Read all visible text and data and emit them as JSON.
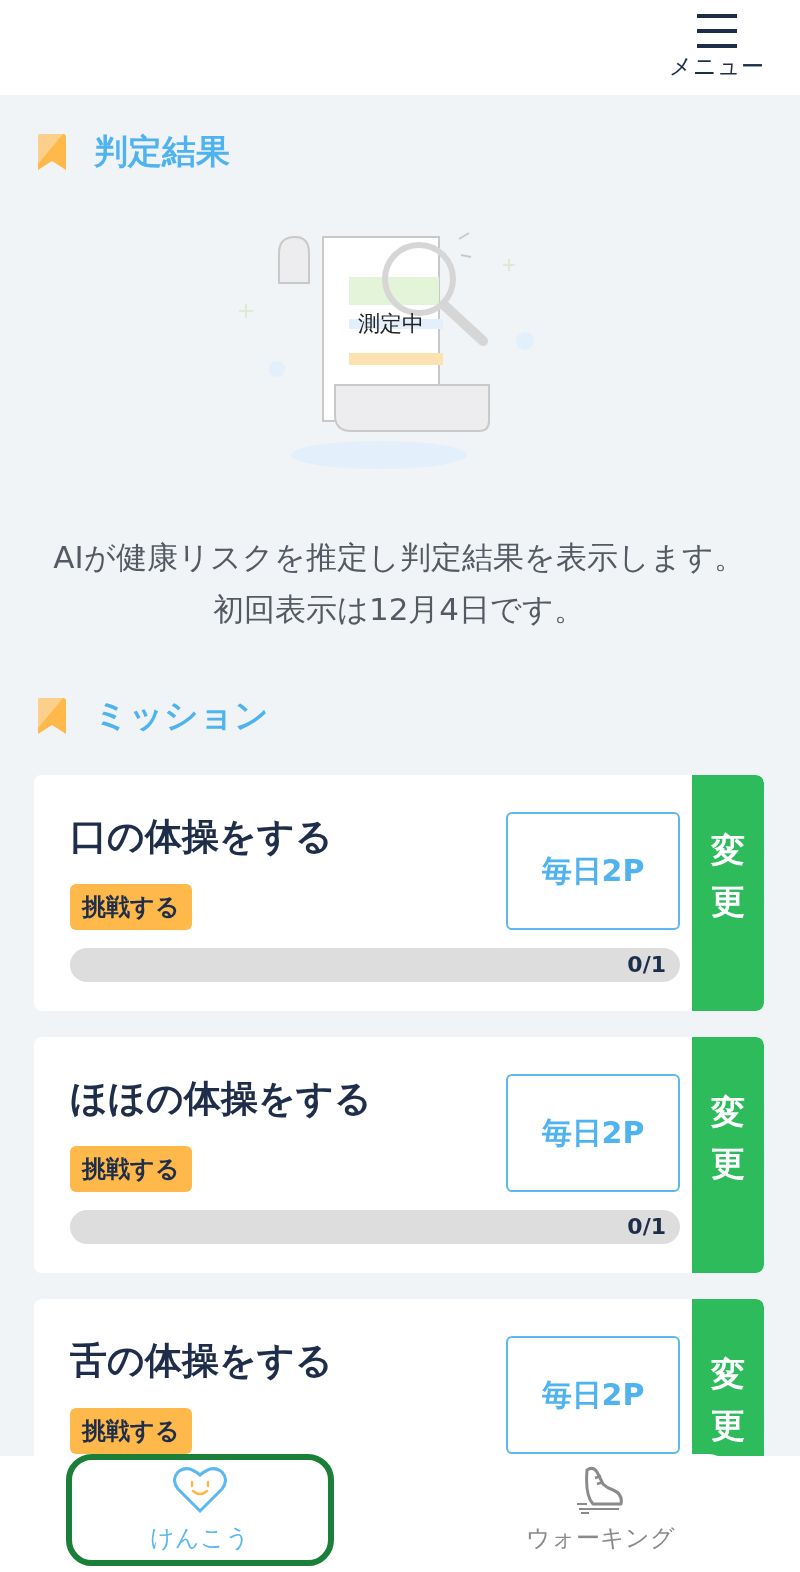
{
  "header": {
    "menu_label": "メニュー"
  },
  "result_section": {
    "title": "判定結果",
    "illustration_label": "測定中",
    "description": "AIが健康リスクを推定し判定結果を表示します。初回表示は12月4日です。"
  },
  "mission_section": {
    "title": "ミッション",
    "missions": [
      {
        "title": "口の体操をする",
        "badge": "挑戦する",
        "points": "毎日2P",
        "change": "変更",
        "progress": {
          "level": 0,
          "reading": "0/1"
        }
      },
      {
        "title": "ほほの体操をする",
        "badge": "挑戦する",
        "points": "毎日2P",
        "change": "変更",
        "progress": {
          "level": 0,
          "reading": "0/1"
        }
      },
      {
        "title": "舌の体操をする",
        "badge": "挑戦する",
        "points": "毎日2P",
        "change": "変更"
      }
    ]
  },
  "bottom_nav": [
    {
      "kind": "health",
      "label": "けんこう",
      "selected": true
    },
    {
      "kind": "walking",
      "label": "ウォーキング",
      "selected": false
    }
  ]
}
